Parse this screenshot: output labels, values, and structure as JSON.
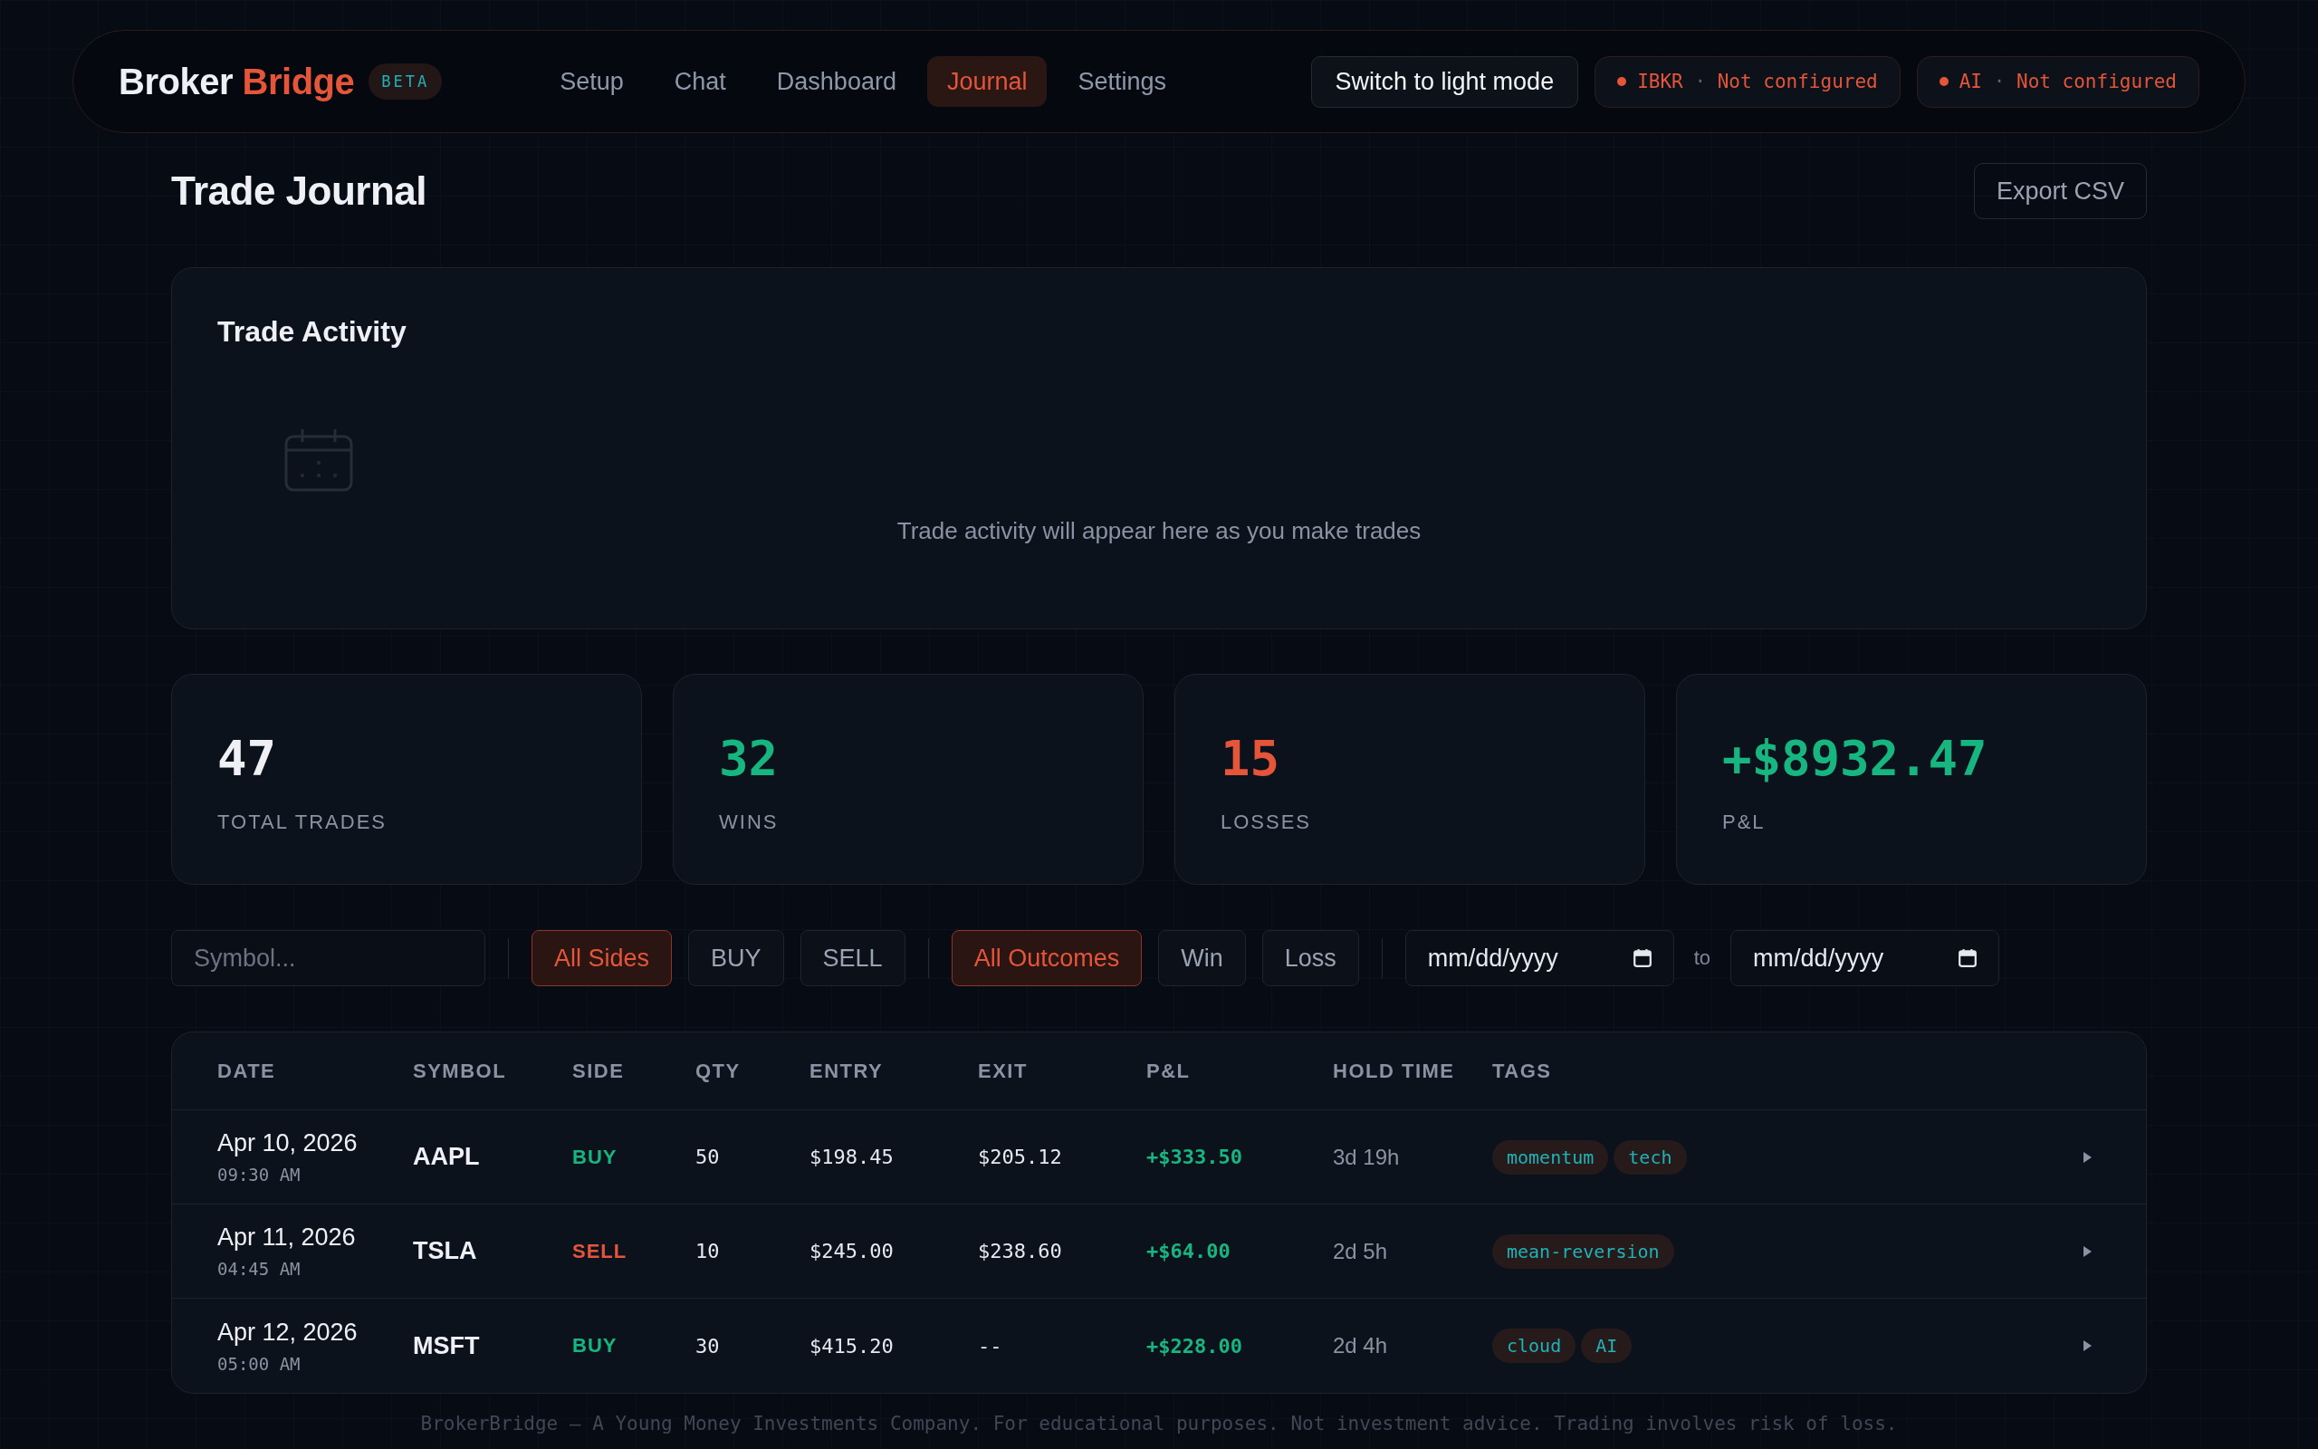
{
  "header": {
    "logo": {
      "first": "Broker",
      "second": "Bridge"
    },
    "badge": "BETA",
    "nav": [
      {
        "label": "Setup",
        "selected": false
      },
      {
        "label": "Chat",
        "selected": false
      },
      {
        "label": "Dashboard",
        "selected": false
      },
      {
        "label": "Journal",
        "selected": true
      },
      {
        "label": "Settings",
        "selected": false
      }
    ],
    "theme_button": "Switch to light mode",
    "connections": [
      {
        "name": "IBKR",
        "separator": "·",
        "status": "Not configured",
        "configured": false
      },
      {
        "name": "AI",
        "separator": "·",
        "status": "Not configured",
        "configured": false
      }
    ]
  },
  "page": {
    "title": "Trade Journal",
    "export_button": "Export CSV"
  },
  "activity": {
    "title": "Trade Activity",
    "empty_message": "Trade activity will appear here as you make trades"
  },
  "stats": [
    {
      "value": "47",
      "label": "TOTAL TRADES",
      "color": "#eef0f5"
    },
    {
      "value": "32",
      "label": "WINS",
      "color": "#17b57f"
    },
    {
      "value": "15",
      "label": "LOSSES",
      "color": "#e4553a"
    },
    {
      "value": "+$8932.47",
      "label": "P&L",
      "color": "#17b57f"
    }
  ],
  "filters": {
    "symbol": {
      "placeholder": "Symbol..."
    },
    "sides": [
      {
        "label": "All Sides",
        "selected": true
      },
      {
        "label": "BUY",
        "selected": false
      },
      {
        "label": "SELL",
        "selected": false
      }
    ],
    "outcomes": [
      {
        "label": "All Outcomes",
        "selected": true
      },
      {
        "label": "Win",
        "selected": false
      },
      {
        "label": "Loss",
        "selected": false
      }
    ],
    "date_from": {
      "placeholder": "mm/dd/yyyy"
    },
    "range_word": "to",
    "date_to": {
      "placeholder": "mm/dd/yyyy"
    }
  },
  "table": {
    "columns": [
      "DATE",
      "SYMBOL",
      "SIDE",
      "QTY",
      "ENTRY",
      "EXIT",
      "P&L",
      "HOLD TIME",
      "TAGS"
    ],
    "rows": [
      {
        "date": "Apr 10, 2026",
        "time": "09:30 AM",
        "symbol": "AAPL",
        "side": {
          "label": "BUY",
          "kind": "buy"
        },
        "qty": "50",
        "entry": "$198.45",
        "exit": "$205.12",
        "pnl": {
          "label": "+$333.50",
          "kind": "gain"
        },
        "hold_time": "3d 19h",
        "tags": [
          "momentum",
          "tech"
        ]
      },
      {
        "date": "Apr 11, 2026",
        "time": "04:45 AM",
        "symbol": "TSLA",
        "side": {
          "label": "SELL",
          "kind": "sell"
        },
        "qty": "10",
        "entry": "$245.00",
        "exit": "$238.60",
        "pnl": {
          "label": "+$64.00",
          "kind": "gain"
        },
        "hold_time": "2d 5h",
        "tags": [
          "mean-reversion"
        ]
      },
      {
        "date": "Apr 12, 2026",
        "time": "05:00 AM",
        "symbol": "MSFT",
        "side": {
          "label": "BUY",
          "kind": "buy"
        },
        "qty": "30",
        "entry": "$415.20",
        "exit": "--",
        "pnl": {
          "label": "+$228.00",
          "kind": "gain"
        },
        "hold_time": "2d 4h",
        "tags": [
          "cloud",
          "AI"
        ]
      }
    ]
  },
  "footer": "BrokerBridge — A Young Money Investments Company. For educational purposes. Not investment advice. Trading involves risk of loss."
}
